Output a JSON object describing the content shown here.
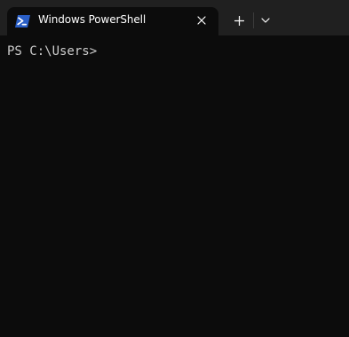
{
  "window": {
    "tab": {
      "title": "Windows PowerShell",
      "icon": "powershell-icon"
    },
    "close_icon": "close-icon",
    "new_tab_icon": "plus-icon",
    "dropdown_icon": "chevron-down-icon"
  },
  "terminal": {
    "prompt": "PS C:\\Users>"
  },
  "colors": {
    "tabbar_bg": "#202020",
    "terminal_bg": "#0c0c0c",
    "terminal_text": "#cccccc",
    "powershell_blue": "#2a5fc7"
  }
}
